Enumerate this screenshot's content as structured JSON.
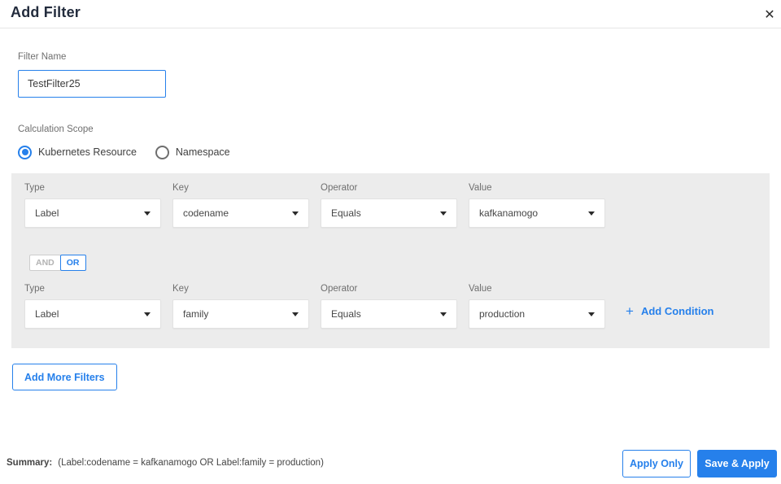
{
  "dialog": {
    "title": "Add Filter",
    "close_glyph": "✕"
  },
  "filter_name": {
    "label": "Filter Name",
    "value": "TestFilter25"
  },
  "calculation_scope": {
    "label": "Calculation Scope",
    "options": [
      {
        "label": "Kubernetes Resource",
        "selected": true
      },
      {
        "label": "Namespace",
        "selected": false
      }
    ]
  },
  "conditions": {
    "column_labels": [
      "Type",
      "Key",
      "Operator",
      "Value"
    ],
    "rows": [
      {
        "type": "Label",
        "key": "codename",
        "operator": "Equals",
        "value": "kafkanamogo"
      },
      {
        "type": "Label",
        "key": "family",
        "operator": "Equals",
        "value": "production"
      }
    ],
    "logic_toggle": {
      "and_label": "AND",
      "or_label": "OR",
      "selected": "OR"
    },
    "add_condition": {
      "plus_glyph": "+",
      "label": "Add Condition"
    }
  },
  "add_more_filters_label": "Add More Filters",
  "footer": {
    "summary_label": "Summary:",
    "summary_text": "(Label:codename = kafkanamogo OR Label:family = production)",
    "apply_only_label": "Apply Only",
    "save_apply_label": "Save & Apply"
  },
  "colors": {
    "accent_blue": "#2680eb",
    "panel_gray": "#ececec",
    "title_dark": "#232c3d"
  }
}
